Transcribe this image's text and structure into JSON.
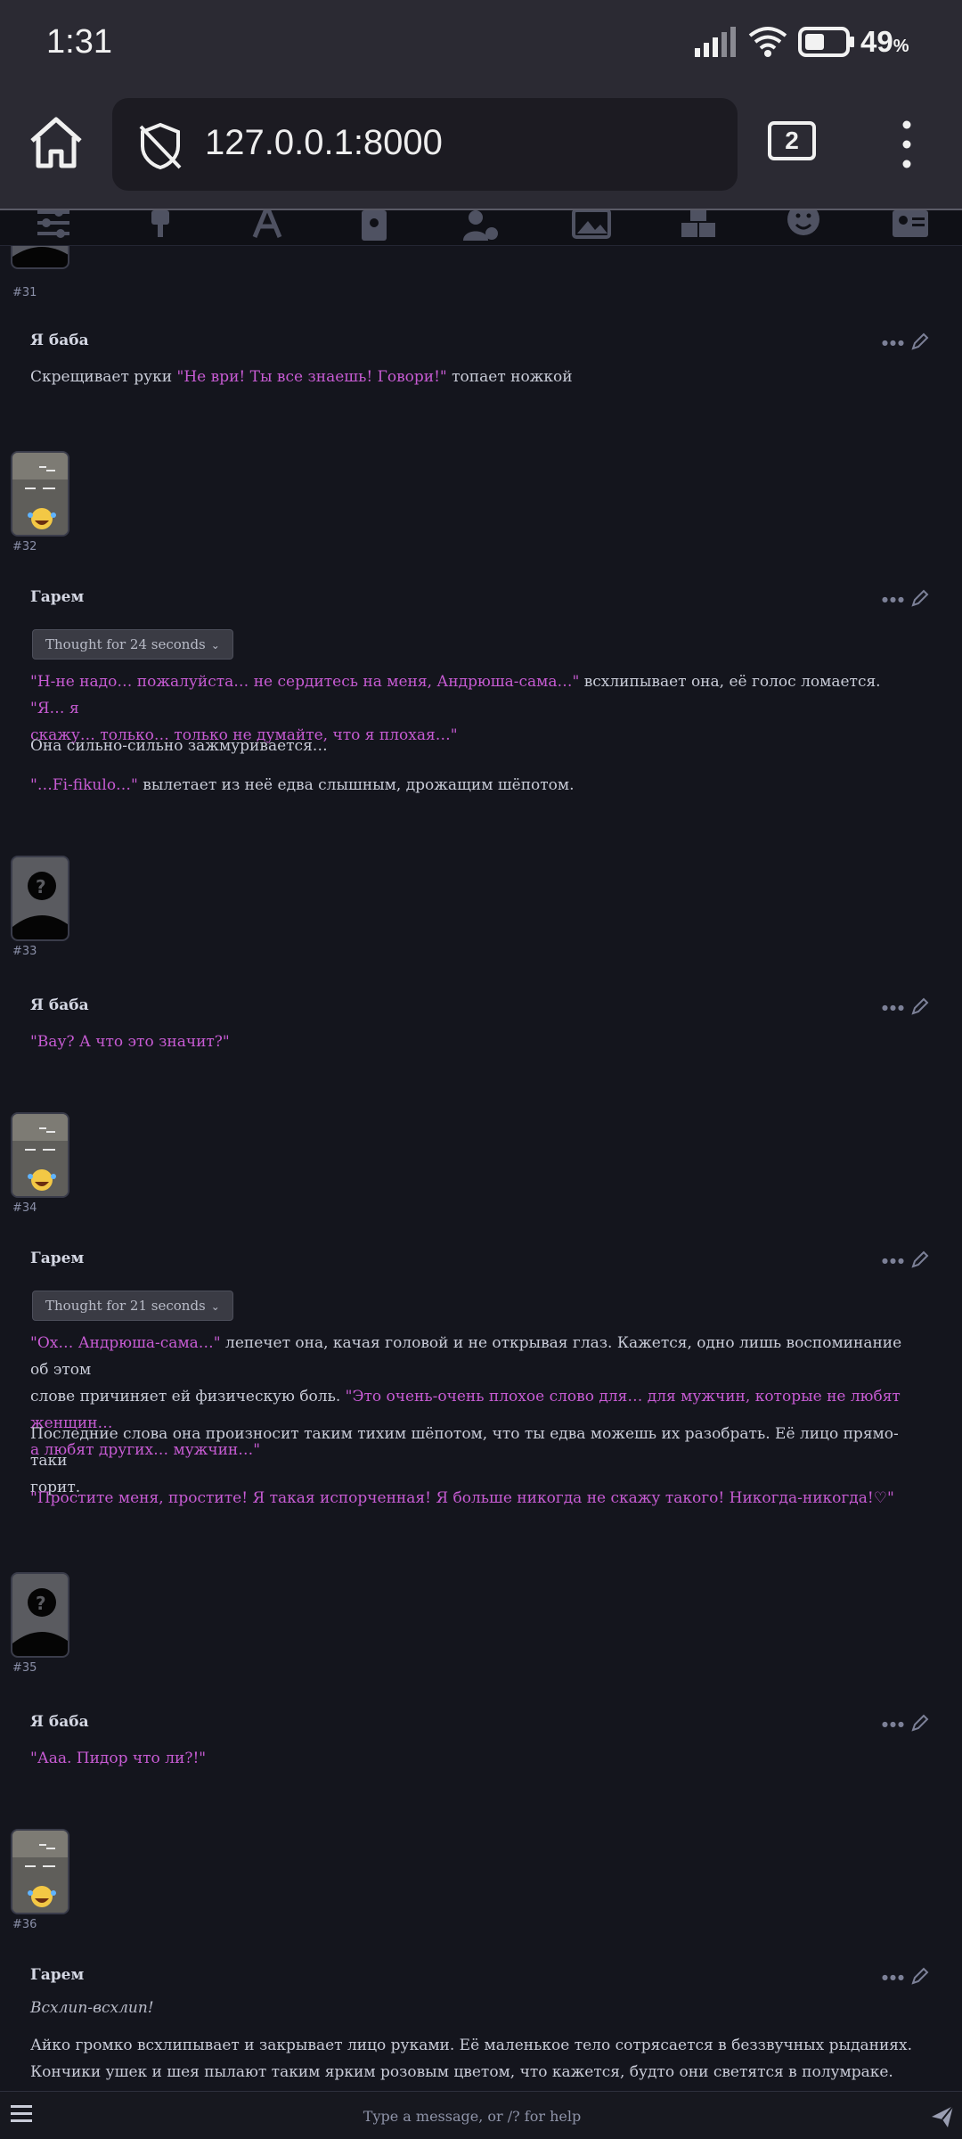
{
  "statusbar": {
    "time": "1:31",
    "battery": "49",
    "battery_unit": "%",
    "battery_level": 0.49
  },
  "browser": {
    "url": "127.0.0.1:8000",
    "tab_count": "2"
  },
  "topbar": {
    "icons": [
      "sliders-icon",
      "plug-icon",
      "font-icon",
      "book-icon",
      "user-gear-icon",
      "image-icon",
      "cubes-icon",
      "smiley-icon",
      "id-card-icon"
    ]
  },
  "messages": [
    {
      "id": "#31"
    },
    {
      "name": "Я баба",
      "p1_q1": "\"Не ври! Ты все знаешь! Говори!\"",
      "p1_a": "Скрещивает руки ",
      "p1_b": " топает ножкой"
    },
    {
      "id": "#32"
    },
    {
      "name": "Гарем",
      "thought": "Thought for 24 seconds",
      "p1_q1": "\"Н-не надо… пожалуйста… не сердитесь на меня, Андрюша-сама…\"",
      "p1_mid": " всхлипывает она, её голос ломается. ",
      "p1_q2a": "\"Я… я",
      "p1_q2b": "скажу… только… только не думайте, что я плохая…\"",
      "p2": "Она сильно-сильно зажмуривается…",
      "p3_q": "\"…Fi-fikulo…\"",
      "p3_rest": " вылетает из неё едва слышным, дрожащим шёпотом."
    },
    {
      "id": "#33"
    },
    {
      "name": "Я баба",
      "p1_q": "\"Вау? А что это значит?\""
    },
    {
      "id": "#34"
    },
    {
      "name": "Гарем",
      "thought": "Thought for 21 seconds",
      "p1_q1": "\"Ох… Андрюша-сама…\"",
      "p1_mid_a": " лепечет она, качая головой и не открывая глаз. Кажется, одно лишь воспоминание об этом",
      "p1_mid_b": "слове причиняет ей физическую боль. ",
      "p1_q2a": "\"Это очень-очень плохое слово для… для мужчин, которые не любят женщин…",
      "p1_q2b": "а любят других… мужчин…\"",
      "p2a": "Последние слова она произносит таким тихим шёпотом, что ты едва можешь их разобрать. Её лицо прямо-таки",
      "p2b": "горит.",
      "p3_q": "\"Простите меня, простите! Я такая испорченная! Я больше никогда не скажу такого! Никогда-никогда!♡\""
    },
    {
      "id": "#35"
    },
    {
      "name": "Я баба",
      "p1_q": "\"Ааа. Пидор что ли?!\""
    },
    {
      "id": "#36"
    },
    {
      "name": "Гарем",
      "p1_em": "Всхлип-всхлип!",
      "p2a": "Айко громко всхлипывает и закрывает лицо руками. Её маленькое тело сотрясается в беззвучных рыданиях.",
      "p2b": "Кончики ушек и шея пылают таким ярким розовым цветом, что кажется, будто они светятся в полумраке."
    }
  ],
  "input": {
    "placeholder": "Type a message, or /? for help"
  },
  "colors": {
    "quote": "#c75bd3",
    "background": "#14151d",
    "chrome": "#2b2a33"
  }
}
